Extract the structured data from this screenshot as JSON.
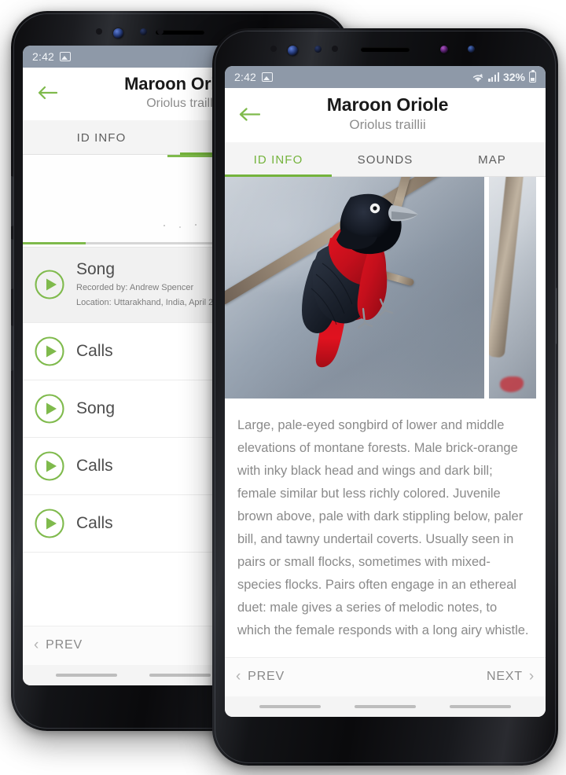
{
  "app": {
    "accent_green": "#74b33c",
    "status_bar_color": "#8e99a8",
    "species_common_name": "Maroon Oriole",
    "species_scientific_name": "Oriolus traillii"
  },
  "status_bar": {
    "time": "2:42",
    "photo_icon": "photo-icon",
    "wifi_icon": "wifi-icon",
    "signal_icon": "signal-bars-icon",
    "battery_percent": "32%",
    "battery_icon": "battery-icon"
  },
  "header": {
    "back_icon": "back-arrow-icon",
    "title": "Maroon Oriole",
    "subtitle": "Oriolus traillii"
  },
  "tabs": [
    {
      "label": "ID INFO",
      "active_front": true,
      "active_back": false
    },
    {
      "label": "SOUNDS",
      "active_front": false,
      "active_back": true
    },
    {
      "label": "MAP",
      "active_front": false,
      "active_back": false
    }
  ],
  "front_screen": {
    "tab_id_info": "ID INFO",
    "tab_sounds": "SOUNDS",
    "tab_map": "MAP",
    "photo_alt": "Maroon Oriole perched on a branch",
    "description": "Large, pale-eyed songbird of lower and middle elevations of montane forests. Male brick-orange with inky black head and wings and dark bill; female similar but less richly colored. Juvenile brown above, pale with dark stippling below, paler bill, and tawny undertail coverts. Usually seen in pairs or small flocks, sometimes with mixed-species flocks. Pairs often engage in an ethereal duet: male gives a series of melodic notes, to which the female responds with a long airy whistle.",
    "prev_label": "PREV",
    "next_label": "NEXT",
    "prev_chevron": "chevron-left-icon",
    "next_chevron": "chevron-right-icon"
  },
  "back_screen": {
    "tab_id_info": "ID INFO",
    "tab_sounds": "SOUNDS",
    "spectrogram_alt": "Audio spectrogram with playhead",
    "prev_label": "PREV",
    "prev_chevron": "chevron-left-icon",
    "sounds": [
      {
        "title": "Song",
        "recorded_by": "Recorded by: Andrew Spencer",
        "location": "Location: Uttarakhand, India, April 20",
        "selected": true,
        "play_icon": "play-circle-icon"
      },
      {
        "title": "Calls",
        "recorded_by": "",
        "location": "",
        "selected": false,
        "play_icon": "play-circle-icon"
      },
      {
        "title": "Song",
        "recorded_by": "",
        "location": "",
        "selected": false,
        "play_icon": "play-circle-icon"
      },
      {
        "title": "Calls",
        "recorded_by": "",
        "location": "",
        "selected": false,
        "play_icon": "play-circle-icon"
      },
      {
        "title": "Calls",
        "recorded_by": "",
        "location": "",
        "selected": false,
        "play_icon": "play-circle-icon"
      }
    ]
  }
}
